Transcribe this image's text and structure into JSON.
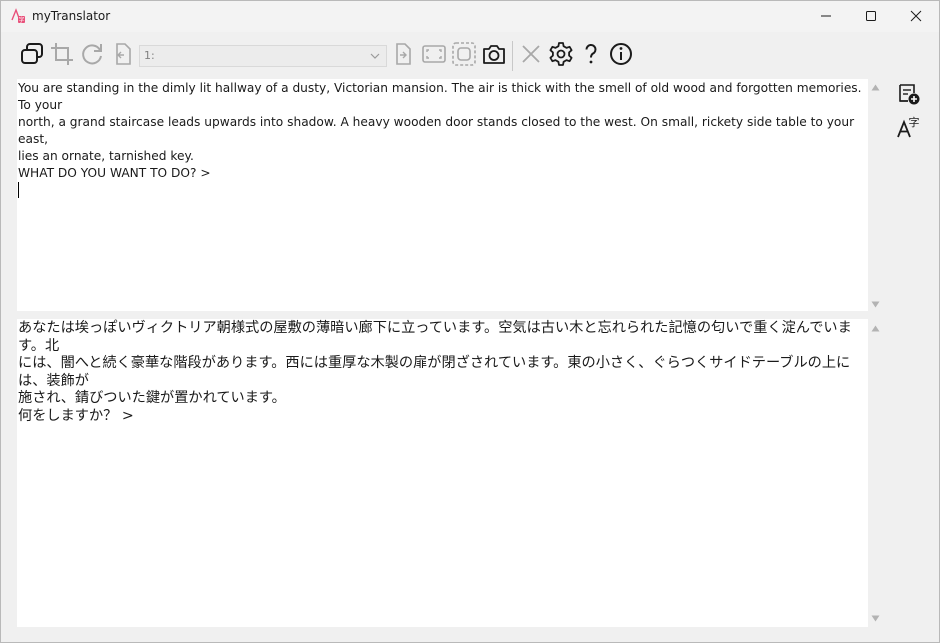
{
  "window": {
    "title": "myTranslator"
  },
  "toolbar": {
    "page_selector_value": "1:"
  },
  "source_pane": {
    "lines": [
      "You are standing in the dimly lit hallway of a dusty, Victorian mansion. The air is thick with the smell of old wood and forgotten memories. To your",
      "north, a grand staircase leads upwards into shadow. A heavy wooden door stands closed to the west. On small, rickety side table to your east,",
      "lies an ornate, tarnished key.",
      "WHAT DO YOU WANT TO DO? >"
    ]
  },
  "translation_pane": {
    "lines": [
      "あなたは埃っぽいヴィクトリア朝様式の屋敷の薄暗い廊下に立っています。空気は古い木と忘れられた記憶の匂いで重く淀んでいます。北",
      "には、闇へと続く豪華な階段があります。西には重厚な木製の扉が閉ざされています。東の小さく、ぐらつくサイドテーブルの上には、装飾が",
      "施され、錆びついた鍵が置かれています。",
      "何をしますか？ >"
    ]
  },
  "icons": {
    "titlebar": [
      "minimize-icon",
      "maximize-icon",
      "close-icon"
    ],
    "toolbar": [
      "overlay-windows-icon",
      "crop-icon",
      "refresh-icon",
      "previous-page-icon",
      "next-page-icon",
      "fullscreen-region-icon",
      "select-region-icon",
      "camera-icon",
      "clear-icon",
      "settings-icon",
      "help-icon",
      "info-icon"
    ],
    "side": [
      "add-note-icon",
      "translate-font-icon"
    ]
  },
  "colors": {
    "background": "#f0f0f0",
    "pane_background": "#ffffff",
    "icon": "#1b1b1b",
    "icon_disabled": "#a8a8a8",
    "app_icon_accent": "#e8507a"
  }
}
